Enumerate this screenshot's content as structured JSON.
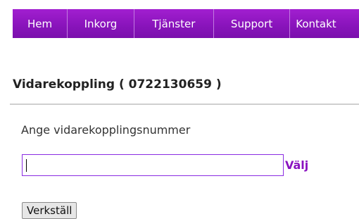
{
  "nav": {
    "items": [
      {
        "label": "Hem"
      },
      {
        "label": "Inkorg"
      },
      {
        "label": "Tjänster"
      },
      {
        "label": "Support"
      },
      {
        "label": "Kontakt"
      }
    ]
  },
  "page": {
    "title": "Vidarekoppling ( 0722130659 )"
  },
  "form": {
    "label": "Ange vidarekopplingsnummer",
    "input_value": "",
    "choose_link": "Välj",
    "apply_button": "Verkställ"
  },
  "colors": {
    "nav_background": "#8a14bc",
    "accent": "#8a12c0"
  }
}
